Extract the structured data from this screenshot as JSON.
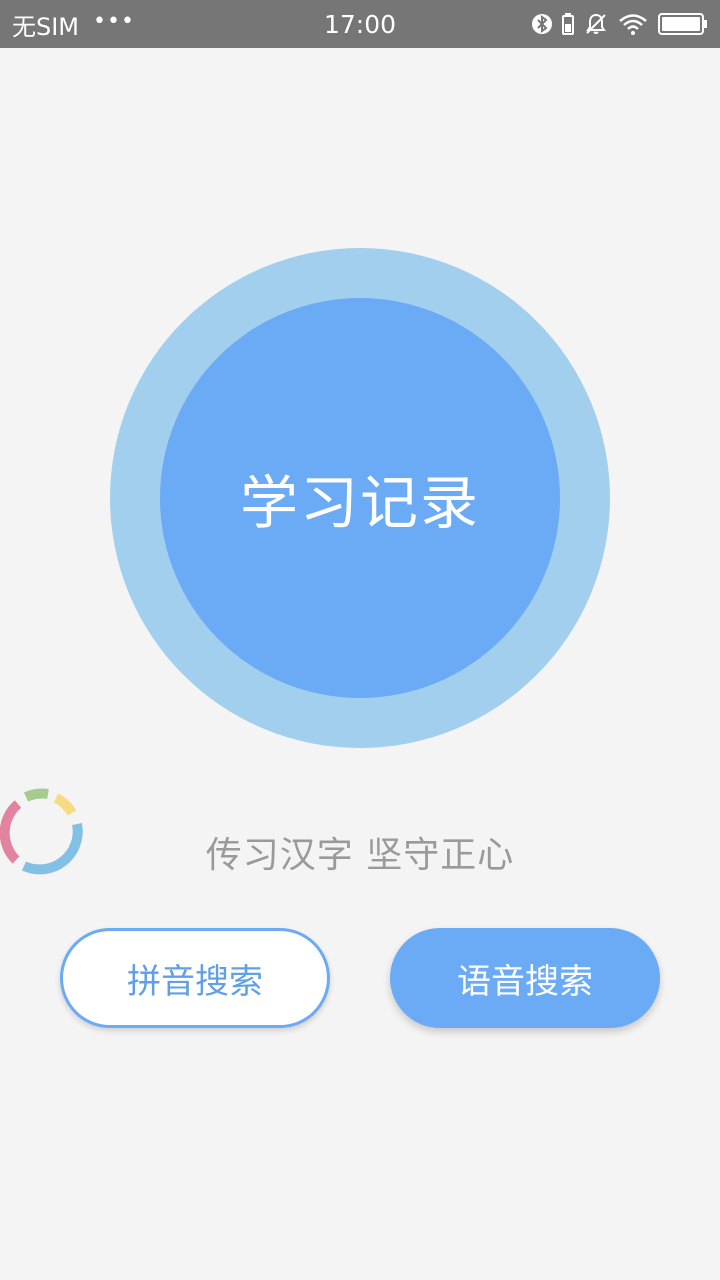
{
  "status_bar": {
    "carrier": "无SIM",
    "dots": "•••",
    "time": "17:00",
    "icons": [
      "bluetooth-icon",
      "battery-small-icon",
      "mute-bell-icon",
      "wifi-icon",
      "battery-icon"
    ]
  },
  "main": {
    "circle_label": "学习记录",
    "slogan": "传习汉字 坚守正心"
  },
  "buttons": {
    "pinyin_search": "拼音搜索",
    "voice_search": "语音搜索"
  },
  "colors": {
    "accent": "#6baaf5",
    "ring": "#a3cfee",
    "background": "#f4f4f4",
    "status_bar": "#767676"
  }
}
